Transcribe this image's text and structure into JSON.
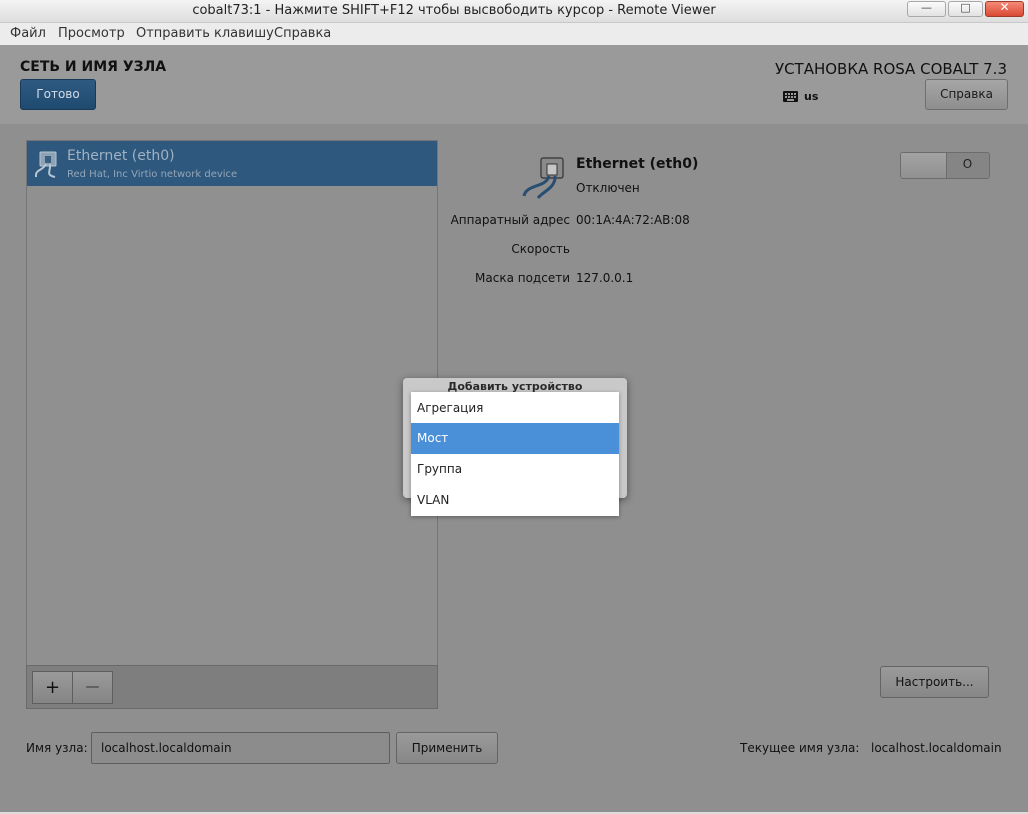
{
  "window": {
    "title": "cobalt73:1 - Нажмите SHIFT+F12 чтобы высвободить курсор - Remote Viewer",
    "minimize_glyph": "—",
    "maximize_glyph": "□",
    "close_glyph": "✕"
  },
  "menubar": {
    "items": [
      "Файл",
      "Просмотр",
      "Отправить клавишу",
      "Справка"
    ]
  },
  "header": {
    "page_title": "СЕТЬ И ИМЯ УЗЛА",
    "done_label": "Готово",
    "product_title": "УСТАНОВКА ROSA COBALT 7.3",
    "keyboard_layout": "us",
    "help_label": "Справка"
  },
  "devices": [
    {
      "name": "Ethernet (eth0)",
      "description": "Red Hat, Inc Virtio network device",
      "selected": true
    }
  ],
  "toolbar": {
    "add_label": "+",
    "remove_label": "—"
  },
  "details": {
    "name": "Ethernet (eth0)",
    "status": "Отключен",
    "hardware_address_label": "Аппаратный адрес",
    "hardware_address_value": "00:1A:4A:72:AB:08",
    "speed_label": "Скорость",
    "speed_value": "",
    "subnet_mask_label": "Маска подсети",
    "subnet_mask_value": "127.0.0.1",
    "switch_state": "O",
    "configure_label": "Настроить..."
  },
  "hostname": {
    "label": "Имя узла:",
    "value": "localhost.localdomain",
    "apply_label": "Применить",
    "current_label": "Текущее имя узла:",
    "current_value": "localhost.localdomain"
  },
  "add_device_dialog": {
    "title": "Добавить устройство",
    "options": [
      "Агрегация",
      "Мост",
      "Группа",
      "VLAN"
    ],
    "selected": "Мост"
  },
  "colors": {
    "selection": "#4a90d9",
    "selected_row": "#2e587d",
    "done_button": "#2e5a82",
    "overlay_content": "#8f8f8f"
  }
}
